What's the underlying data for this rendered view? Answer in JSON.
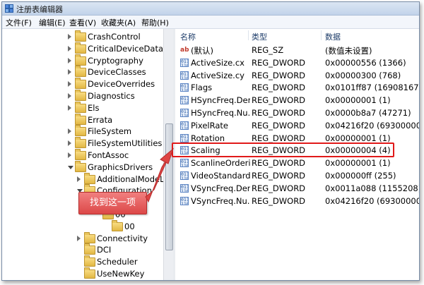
{
  "window": {
    "title": "注册表编辑器"
  },
  "menu": [
    "文件(F)",
    "编辑(E)",
    "查看(V)",
    "收藏夹(A)",
    "帮助(H)"
  ],
  "tree": [
    {
      "label": "CrashControl",
      "indent": 0,
      "expand": "closed"
    },
    {
      "label": "CriticalDeviceDatabase",
      "indent": 0,
      "expand": "closed"
    },
    {
      "label": "Cryptography",
      "indent": 0,
      "expand": "closed"
    },
    {
      "label": "DeviceClasses",
      "indent": 0,
      "expand": "closed"
    },
    {
      "label": "DeviceOverrides",
      "indent": 0,
      "expand": "closed"
    },
    {
      "label": "Diagnostics",
      "indent": 0,
      "expand": "closed"
    },
    {
      "label": "Els",
      "indent": 0,
      "expand": "closed"
    },
    {
      "label": "Errata",
      "indent": 0,
      "expand": "none"
    },
    {
      "label": "FileSystem",
      "indent": 0,
      "expand": "closed"
    },
    {
      "label": "FileSystemUtilities",
      "indent": 0,
      "expand": "closed"
    },
    {
      "label": "FontAssoc",
      "indent": 0,
      "expand": "closed"
    },
    {
      "label": "GraphicsDrivers",
      "indent": 0,
      "expand": "open"
    },
    {
      "label": "AdditionalModeLists",
      "indent": 1,
      "expand": "closed"
    },
    {
      "label": "Configuration",
      "indent": 1,
      "expand": "open"
    },
    {
      "label": "…1F_0",
      "indent": 2,
      "expand": "open"
    },
    {
      "label": "00",
      "indent": 3,
      "expand": "none"
    },
    {
      "label": "00",
      "indent": 4,
      "expand": "none"
    },
    {
      "label": "Connectivity",
      "indent": 1,
      "expand": "closed"
    },
    {
      "label": "DCI",
      "indent": 1,
      "expand": "none"
    },
    {
      "label": "Scheduler",
      "indent": 1,
      "expand": "none"
    },
    {
      "label": "UseNewKey",
      "indent": 1,
      "expand": "none"
    }
  ],
  "columns": {
    "name": "名称",
    "type": "类型",
    "data": "数据"
  },
  "values": [
    {
      "icon": "ab",
      "name": "(默认)",
      "type": "REG_SZ",
      "data": "(数值未设置)"
    },
    {
      "icon": "bin",
      "name": "ActiveSize.cx",
      "type": "REG_DWORD",
      "data": "0x00000556 (1366)"
    },
    {
      "icon": "bin",
      "name": "ActiveSize.cy",
      "type": "REG_DWORD",
      "data": "0x00000300 (768)"
    },
    {
      "icon": "bin",
      "name": "Flags",
      "type": "REG_DWORD",
      "data": "0x0101ff87 (16908167)"
    },
    {
      "icon": "bin",
      "name": "HSyncFreq.Den...",
      "type": "REG_DWORD",
      "data": "0x00000001 (1)"
    },
    {
      "icon": "bin",
      "name": "HSyncFreq.Nu...",
      "type": "REG_DWORD",
      "data": "0x0000b8a7 (47271)"
    },
    {
      "icon": "bin",
      "name": "PixelRate",
      "type": "REG_DWORD",
      "data": "0x04216f20 (69300000)"
    },
    {
      "icon": "bin",
      "name": "Rotation",
      "type": "REG_DWORD",
      "data": "0x00000001 (1)"
    },
    {
      "icon": "bin",
      "name": "Scaling",
      "type": "REG_DWORD",
      "data": "0x00000004 (4)"
    },
    {
      "icon": "bin",
      "name": "ScanlineOrderi...",
      "type": "REG_DWORD",
      "data": "0x00000001 (1)"
    },
    {
      "icon": "bin",
      "name": "VideoStandard",
      "type": "REG_DWORD",
      "data": "0x000000ff (255)"
    },
    {
      "icon": "bin",
      "name": "VSyncFreq.Den...",
      "type": "REG_DWORD",
      "data": "0x0011a088 (1155208)"
    },
    {
      "icon": "bin",
      "name": "VSyncFreq.Nu...",
      "type": "REG_DWORD",
      "data": "0x04216f20 (69300000)"
    }
  ],
  "callout": {
    "text": "找到这一项"
  },
  "colors": {
    "highlight": "#e11919",
    "callout_fill": "#e65a5a"
  }
}
